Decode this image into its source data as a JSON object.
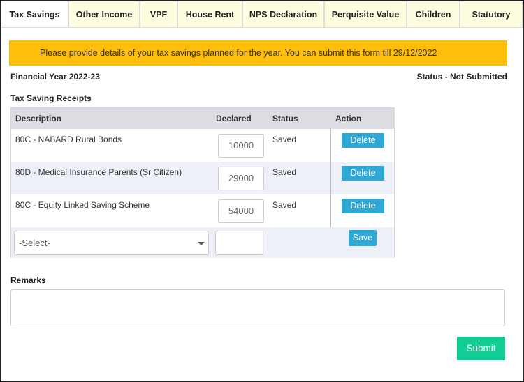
{
  "tabs": [
    {
      "label": "Tax Savings",
      "active": true
    },
    {
      "label": "Other Income",
      "active": false
    },
    {
      "label": "VPF",
      "active": false
    },
    {
      "label": "House Rent",
      "active": false
    },
    {
      "label": "NPS Declaration",
      "active": false
    },
    {
      "label": "Perquisite Value",
      "active": false
    },
    {
      "label": "Children",
      "active": false
    },
    {
      "label": "Statutory",
      "active": false
    }
  ],
  "alert": "Please provide details of your tax savings planned for the year. You can submit this form till 29/12/2022",
  "financial_year": "Financial Year 2022-23",
  "status_text": "Status - Not Submitted",
  "section_title": "Tax Saving Receipts",
  "table": {
    "headers": {
      "description": "Description",
      "declared": "Declared",
      "status": "Status",
      "action": "Action"
    },
    "rows": [
      {
        "description": "80C - NABARD Rural Bonds",
        "declared": "10000",
        "status": "Saved",
        "action": "Delete"
      },
      {
        "description": "80D - Medical Insurance Parents (Sr Citizen)",
        "declared": "29000",
        "status": "Saved",
        "action": "Delete"
      },
      {
        "description": "80C - Equity Linked Saving Scheme",
        "declared": "54000",
        "status": "Saved",
        "action": "Delete"
      }
    ],
    "new_row": {
      "select_value": "-Select-",
      "amount": "",
      "save_label": "Save"
    }
  },
  "remarks_label": "Remarks",
  "remarks_value": "",
  "submit_label": "Submit",
  "colors": {
    "alert": "#ffbe0b",
    "button": "#2ea9d6",
    "submit": "#11cc94",
    "tab_inactive": "#fffde0"
  }
}
